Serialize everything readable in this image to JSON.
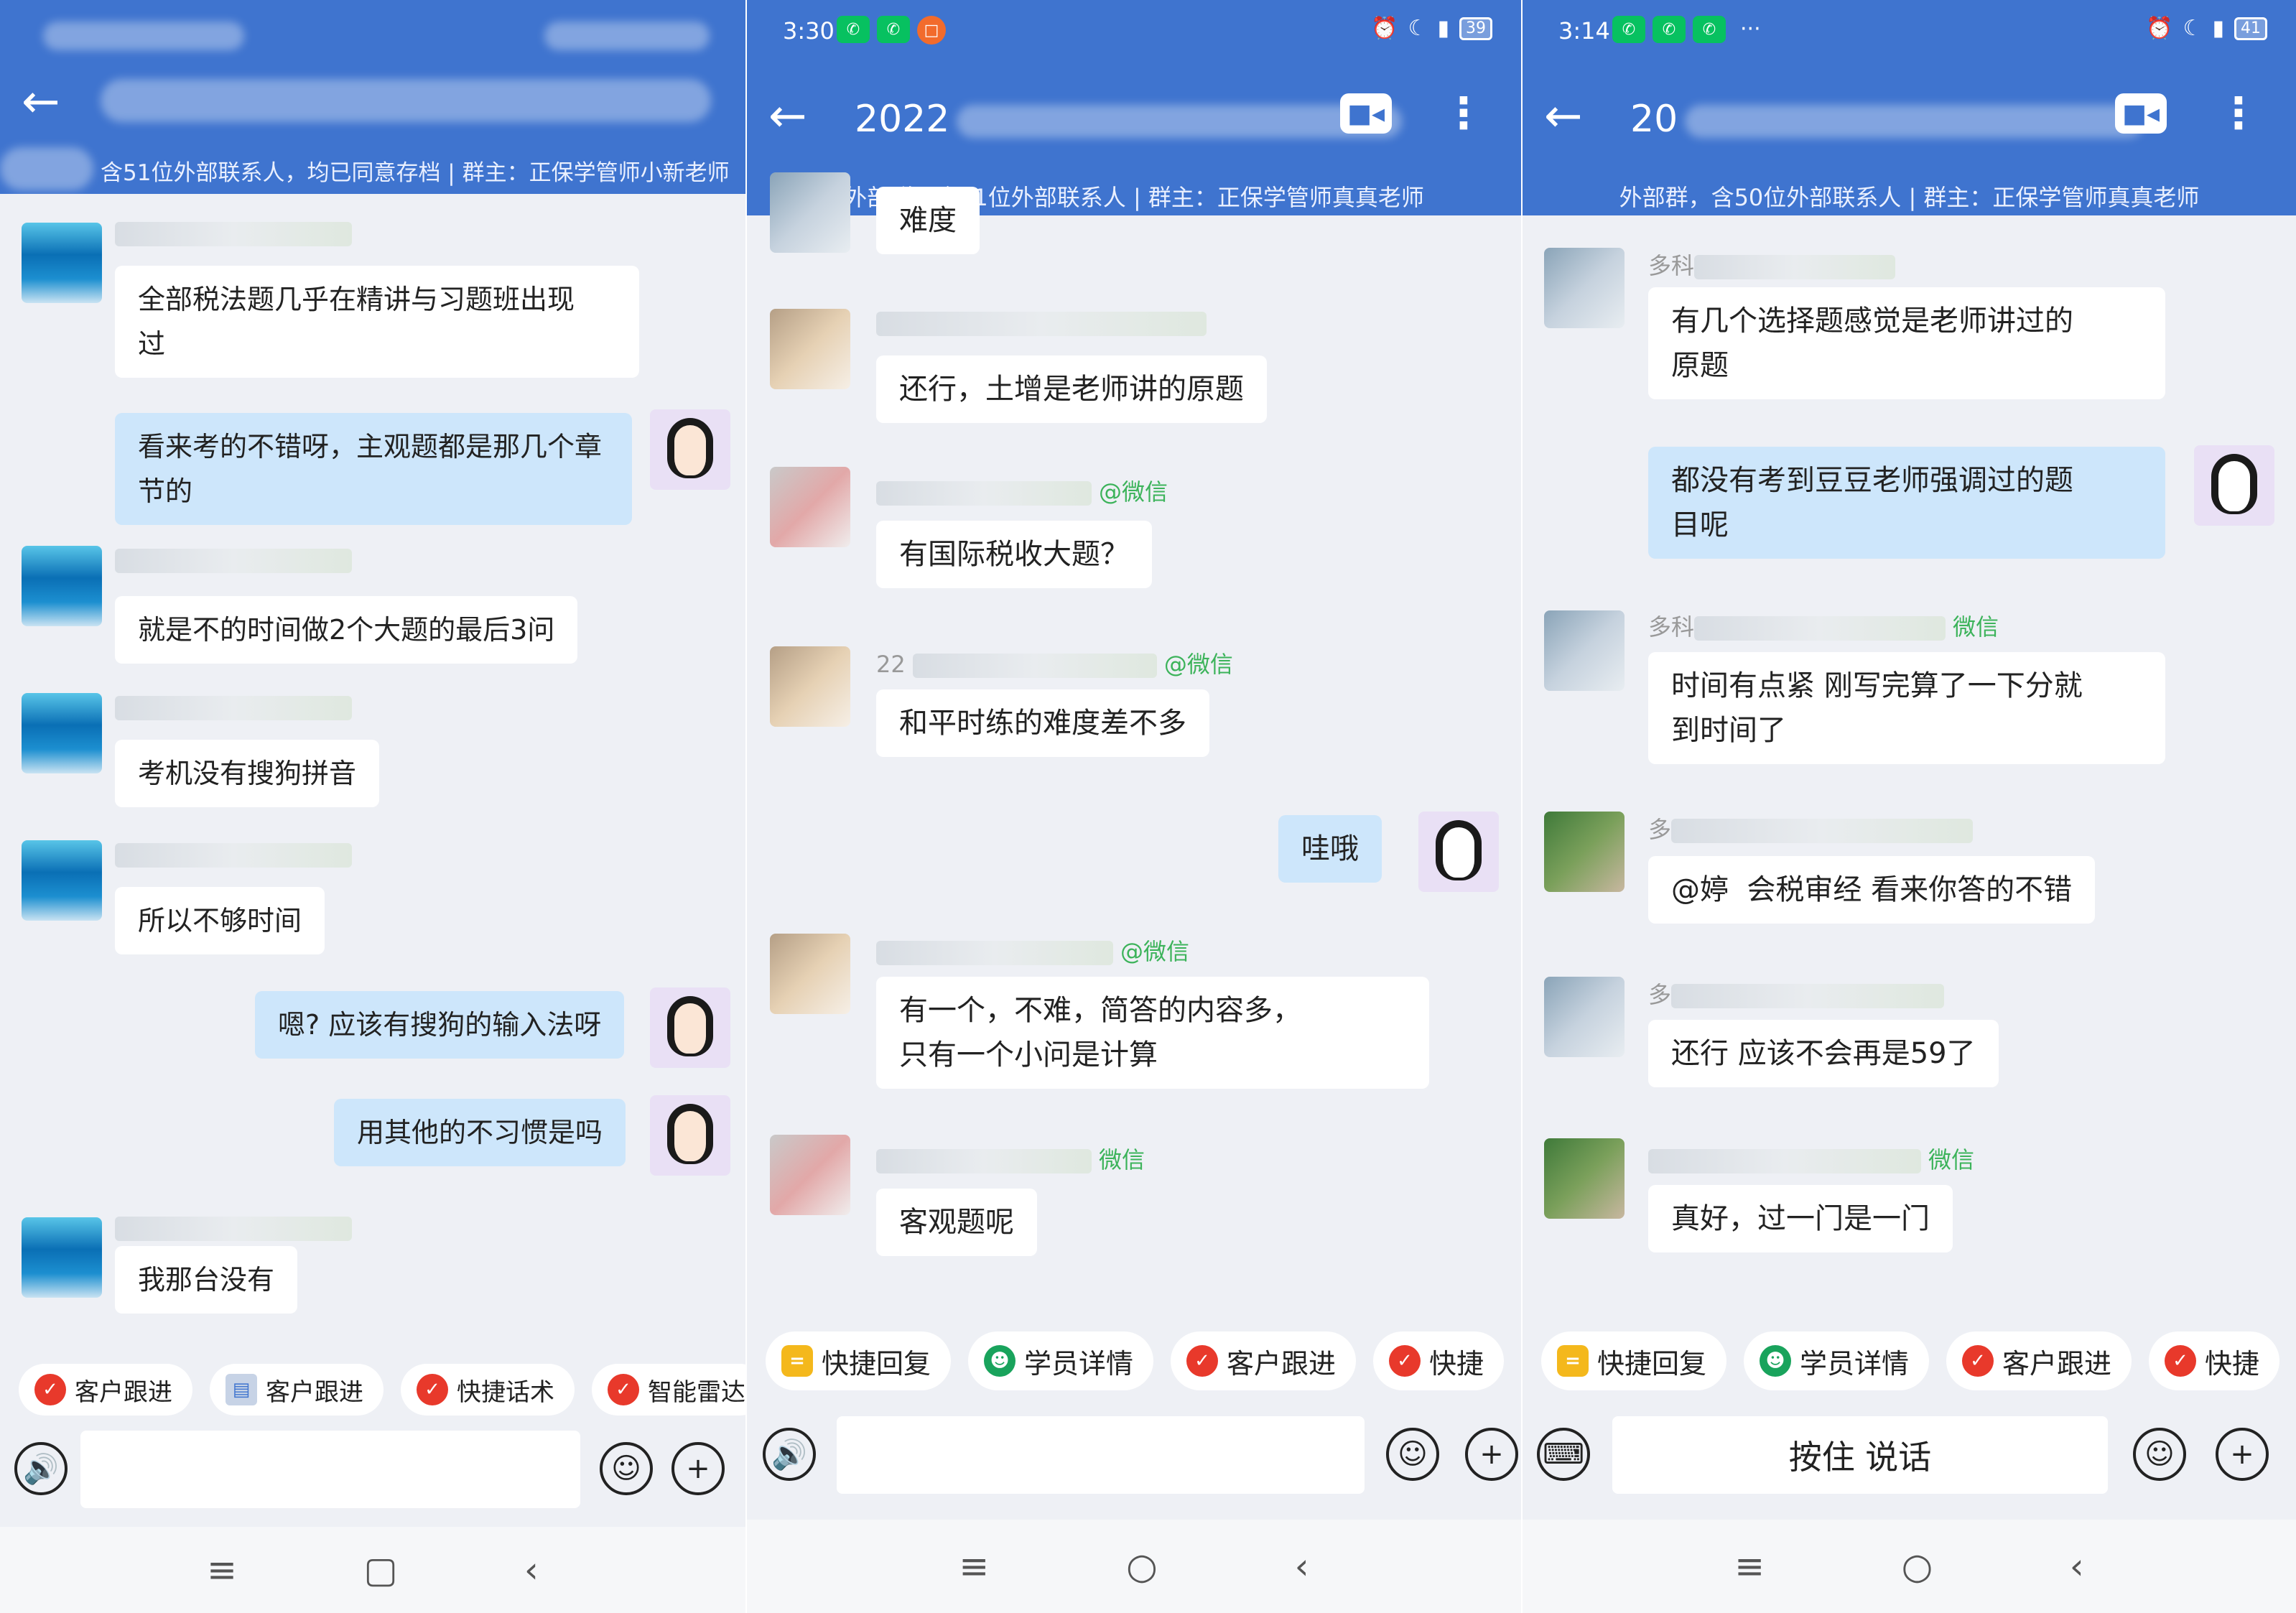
{
  "panels": [
    {
      "status_time": "",
      "subtitle": "含51位外部联系人，均已同意存档 | 群主：正保学管师小新老师",
      "messages": [
        "全部税法题几乎在精讲与习题班出现\n过",
        "看来考的不错呀，主观题都是那几个章\n节的",
        "就是不的时间做2个大题的最后3问",
        "考机没有搜狗拼音",
        "所以不够时间",
        "嗯? 应该有搜狗的输入法呀",
        "用其他的不习惯是吗",
        "我那台没有"
      ],
      "quick_replies": [
        "客户跟进",
        "客户跟进",
        "快捷话术",
        "智能雷达"
      ]
    },
    {
      "status_time": "3:30",
      "battery": "39",
      "title_fragment": "2022",
      "subtitle": "外部群，含51位外部联系人 | 群主：正保学管师真真老师",
      "name_tags": [
        "@微信",
        "@微信",
        "@微信",
        "微信"
      ],
      "name_prefix": "22",
      "messages": [
        "难度",
        "还行，土增是老师讲的原题",
        "有国际税收大题？",
        "和平时练的难度差不多",
        "哇哦",
        "有一个，不难，简答的内容多，\n只有一个小问是计算",
        "客观题呢"
      ],
      "quick_replies": [
        "快捷回复",
        "学员详情",
        "客户跟进",
        "快捷"
      ]
    },
    {
      "status_time": "3:14",
      "battery": "41",
      "title_fragment": "20",
      "subtitle": "外部群，含50位外部联系人 | 群主：正保学管师真真老师",
      "name_prefixes": [
        "多科",
        "多科",
        "多",
        "多"
      ],
      "name_tags": [
        "微信",
        "微信"
      ],
      "messages": [
        "有几个选择题感觉是老师讲过的\n原题",
        "都没有考到豆豆老师强调过的题\n目呢",
        "时间有点紧 刚写完算了一下分就\n到时间了",
        "@婷  会税审经 看来你答的不错",
        "还行 应该不会再是59了",
        "真好，过一门是一门"
      ],
      "quick_replies": [
        "快捷回复",
        "学员详情",
        "客户跟进",
        "快捷"
      ],
      "hold_to_talk": "按住 说话"
    }
  ],
  "icons": {
    "back": "back-arrow-icon",
    "call": "video-call-icon",
    "more": "more-vertical-icon",
    "voice": "voice-icon",
    "keyboard": "keyboard-icon",
    "emoji": "emoji-icon",
    "plus": "plus-icon"
  },
  "colors": {
    "header": "#3f74cf",
    "chat_bg": "#eef0f5",
    "my_bubble": "#cde6fb",
    "wechat_tag": "#3cb35a"
  }
}
